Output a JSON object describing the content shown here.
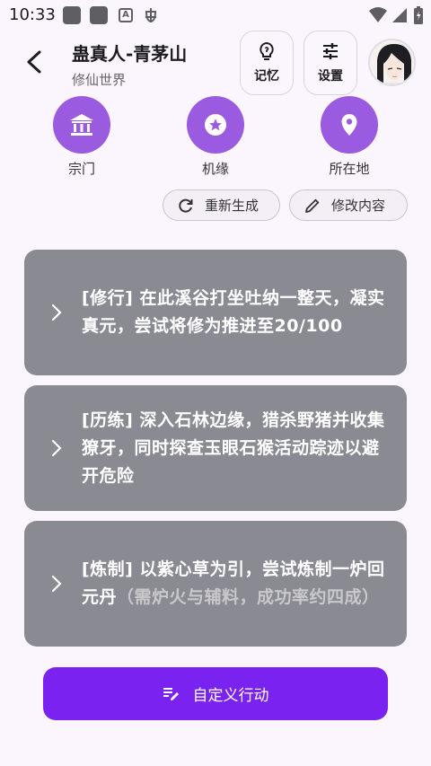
{
  "status_bar": {
    "time": "10:33",
    "icons": [
      "app-square-icon",
      "app-square-icon",
      "a-box-icon",
      "bug-icon",
      "wifi-icon",
      "signal-icon",
      "battery-icon"
    ]
  },
  "header": {
    "title": "蛊真人-青茅山",
    "subtitle": "修仙世界",
    "memory_label": "记忆",
    "settings_label": "设置"
  },
  "categories": [
    {
      "label": "宗门",
      "icon": "temple-icon"
    },
    {
      "label": "机缘",
      "icon": "star-badge-icon"
    },
    {
      "label": "所在地",
      "icon": "location-pin-icon"
    }
  ],
  "pills": {
    "regenerate": "重新生成",
    "edit": "修改内容"
  },
  "actions": [
    {
      "text": "[修行] 在此溪谷打坐吐纳一整天，凝实真元，尝试将修为推进至20/100",
      "muted": ""
    },
    {
      "text": "[历练] 深入石林边缘，猎杀野猪并收集獠牙，同时探查玉眼石猴活动踪迹以避开危险",
      "muted": ""
    },
    {
      "text": "[炼制] 以紫心草为引，尝试炼制一炉回元丹",
      "muted": "（需炉火与辅料，成功率约四成）"
    }
  ],
  "custom_action": "自定义行动",
  "colors": {
    "accent": "#7a22f0",
    "category": "#9a5be0",
    "card": "#8a8a92",
    "background": "#fbf6fd"
  }
}
